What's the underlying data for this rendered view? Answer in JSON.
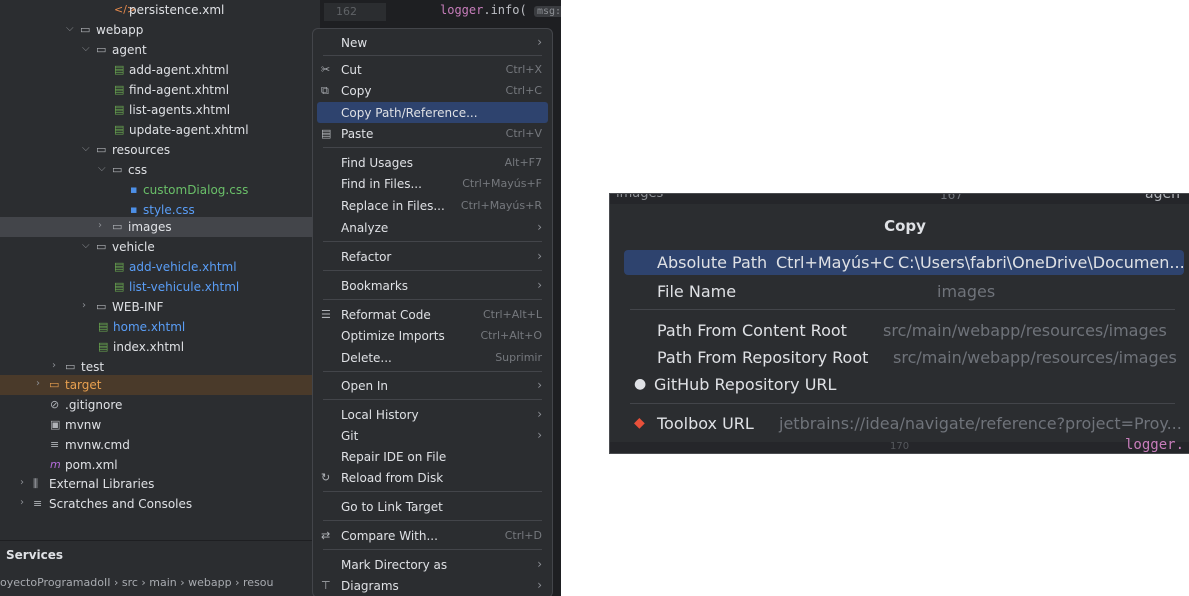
{
  "tree": {
    "rows": [
      {
        "label": "persistence.xml",
        "icon": "xml-icon"
      },
      {
        "label": "webapp"
      },
      {
        "label": "agent"
      },
      {
        "label": "add-agent.xhtml"
      },
      {
        "label": "find-agent.xhtml"
      },
      {
        "label": "list-agents.xhtml"
      },
      {
        "label": "update-agent.xhtml"
      },
      {
        "label": "resources"
      },
      {
        "label": "css"
      },
      {
        "label": "customDialog.css"
      },
      {
        "label": "style.css"
      },
      {
        "label": "images"
      },
      {
        "label": "vehicle"
      },
      {
        "label": "add-vehicle.xhtml"
      },
      {
        "label": "list-vehicule.xhtml"
      },
      {
        "label": "WEB-INF"
      },
      {
        "label": "home.xhtml"
      },
      {
        "label": "index.xhtml"
      },
      {
        "label": "test"
      },
      {
        "label": "target"
      },
      {
        "label": ".gitignore"
      },
      {
        "label": "mvnw"
      },
      {
        "label": "mvnw.cmd"
      },
      {
        "label": "pom.xml"
      },
      {
        "label": "External Libraries"
      },
      {
        "label": "Scratches and Consoles"
      }
    ]
  },
  "editor": {
    "line_number": "162",
    "code_fn": "logger",
    "code_rest": ".info(",
    "hint": "msg:"
  },
  "services": {
    "label": "Services"
  },
  "breadcrumb": {
    "text": "oyectoProgramadoII › src › main › webapp › resou"
  },
  "menu": {
    "items": [
      {
        "label": "New"
      },
      {
        "label": "Cut",
        "shortcut": "Ctrl+X"
      },
      {
        "label": "Copy",
        "shortcut": "Ctrl+C"
      },
      {
        "label": "Copy Path/Reference..."
      },
      {
        "label": "Paste",
        "shortcut": "Ctrl+V"
      },
      {
        "label": "Find Usages",
        "shortcut": "Alt+F7"
      },
      {
        "label": "Find in Files...",
        "shortcut": "Ctrl+Mayús+F"
      },
      {
        "label": "Replace in Files...",
        "shortcut": "Ctrl+Mayús+R"
      },
      {
        "label": "Analyze"
      },
      {
        "label": "Refactor"
      },
      {
        "label": "Bookmarks"
      },
      {
        "label": "Reformat Code",
        "shortcut": "Ctrl+Alt+L"
      },
      {
        "label": "Optimize Imports",
        "shortcut": "Ctrl+Alt+O"
      },
      {
        "label": "Delete...",
        "shortcut": "Suprimir"
      },
      {
        "label": "Open In"
      },
      {
        "label": "Local History"
      },
      {
        "label": "Git"
      },
      {
        "label": "Repair IDE on File"
      },
      {
        "label": "Reload from Disk"
      },
      {
        "label": "Go to Link Target"
      },
      {
        "label": "Compare With...",
        "shortcut": "Ctrl+D"
      },
      {
        "label": "Mark Directory as"
      },
      {
        "label": "Diagrams"
      }
    ]
  },
  "popup": {
    "top_left": "images",
    "top_mid": "167",
    "top_right": "agen",
    "title": "Copy",
    "rows": [
      {
        "label": "Absolute Path",
        "shortcut": "Ctrl+Mayús+C",
        "value": "C:\\Users\\fabri\\OneDrive\\Documen..."
      },
      {
        "label": "File Name",
        "value": "images"
      },
      {
        "label": "Path From Content Root",
        "value": "src/main/webapp/resources/images"
      },
      {
        "label": "Path From Repository Root",
        "value": "src/main/webapp/resources/images"
      },
      {
        "label": "GitHub Repository URL"
      },
      {
        "label": "Toolbox URL",
        "value": "jetbrains://idea/navigate/reference?project=Proy..."
      }
    ],
    "bottom_mid": "170",
    "bottom_right": "logger."
  }
}
